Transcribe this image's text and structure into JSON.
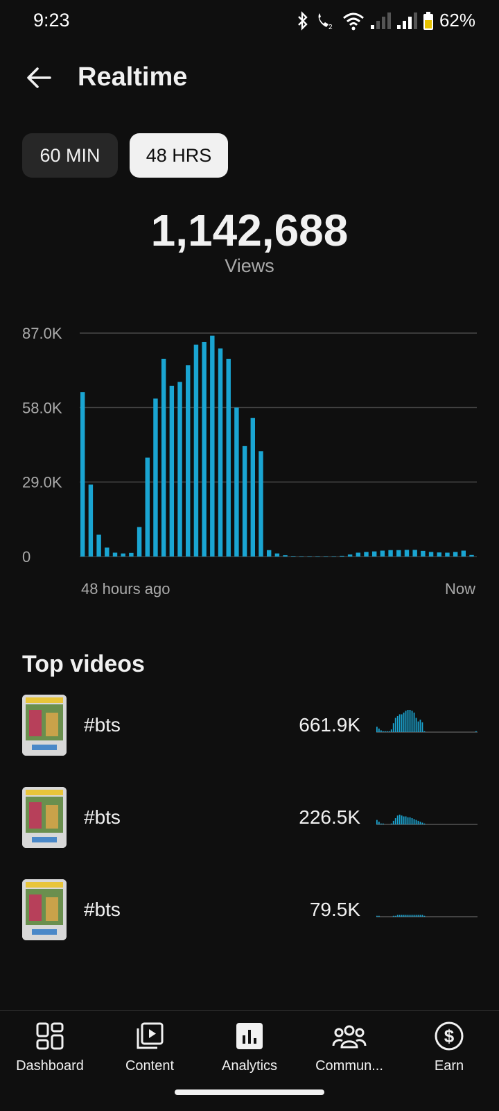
{
  "status": {
    "time": "9:23",
    "battery": "62%"
  },
  "header": {
    "title": "Realtime"
  },
  "tabs": [
    {
      "label": "60 MIN",
      "selected": false
    },
    {
      "label": "48 HRS",
      "selected": true
    }
  ],
  "summary": {
    "total": "1,142,688",
    "label": "Views"
  },
  "chart_data": {
    "type": "bar",
    "y_tick_labels": [
      "87.0K",
      "58.0K",
      "29.0K",
      "0"
    ],
    "y_ticks": [
      87000,
      58000,
      29000,
      0
    ],
    "ylim": [
      0,
      87000
    ],
    "x_start_label": "48 hours ago",
    "x_end_label": "Now",
    "grid": true,
    "color": "#1aa5d2",
    "values": [
      64000,
      28000,
      8500,
      3500,
      1500,
      1200,
      1400,
      11500,
      38500,
      61500,
      77000,
      66500,
      68000,
      74500,
      82500,
      83500,
      86000,
      81000,
      77000,
      58000,
      43000,
      54000,
      41000,
      2500,
      1200,
      500,
      200,
      100,
      100,
      100,
      100,
      100,
      300,
      800,
      1500,
      1800,
      2000,
      2300,
      2500,
      2500,
      2600,
      2600,
      2200,
      1800,
      1600,
      1500,
      1800,
      2300,
      600
    ]
  },
  "top_videos": {
    "title": "Top videos",
    "items": [
      {
        "title": "#bts",
        "views": "661.9K",
        "spark": [
          6,
          4,
          2,
          1,
          1,
          1,
          1,
          3,
          10,
          16,
          18,
          20,
          20,
          22,
          24,
          25,
          25,
          24,
          22,
          16,
          12,
          14,
          11,
          1,
          0,
          0,
          0,
          0,
          0,
          0,
          0,
          0,
          0,
          0,
          0,
          0,
          0,
          0,
          0,
          0,
          0,
          0,
          0,
          0,
          0,
          0,
          0,
          0,
          1
        ]
      },
      {
        "title": "#bts",
        "views": "226.5K",
        "spark": [
          5,
          3,
          1,
          1,
          0,
          0,
          0,
          1,
          4,
          7,
          10,
          11,
          10,
          9,
          9,
          8,
          8,
          7,
          6,
          5,
          4,
          3,
          2,
          1,
          0,
          0,
          0,
          0,
          0,
          0,
          0,
          0,
          0,
          0,
          0,
          0,
          0,
          0,
          0,
          0,
          0,
          0,
          0,
          0,
          0,
          0,
          0,
          0,
          0
        ]
      },
      {
        "title": "#bts",
        "views": "79.5K",
        "spark": [
          1,
          1,
          0,
          0,
          0,
          0,
          0,
          0,
          1,
          1,
          2,
          2,
          2,
          2,
          2,
          2,
          2,
          2,
          2,
          2,
          2,
          2,
          2,
          1,
          0,
          0,
          0,
          0,
          0,
          0,
          0,
          0,
          0,
          0,
          0,
          0,
          0,
          0,
          0,
          0,
          0,
          0,
          0,
          0,
          0,
          0,
          0,
          0,
          0
        ]
      }
    ]
  },
  "nav": [
    {
      "label": "Dashboard",
      "icon": "dashboard-icon"
    },
    {
      "label": "Content",
      "icon": "content-icon"
    },
    {
      "label": "Analytics",
      "icon": "analytics-icon",
      "selected": true
    },
    {
      "label": "Commun...",
      "icon": "community-icon"
    },
    {
      "label": "Earn",
      "icon": "earn-icon"
    }
  ]
}
